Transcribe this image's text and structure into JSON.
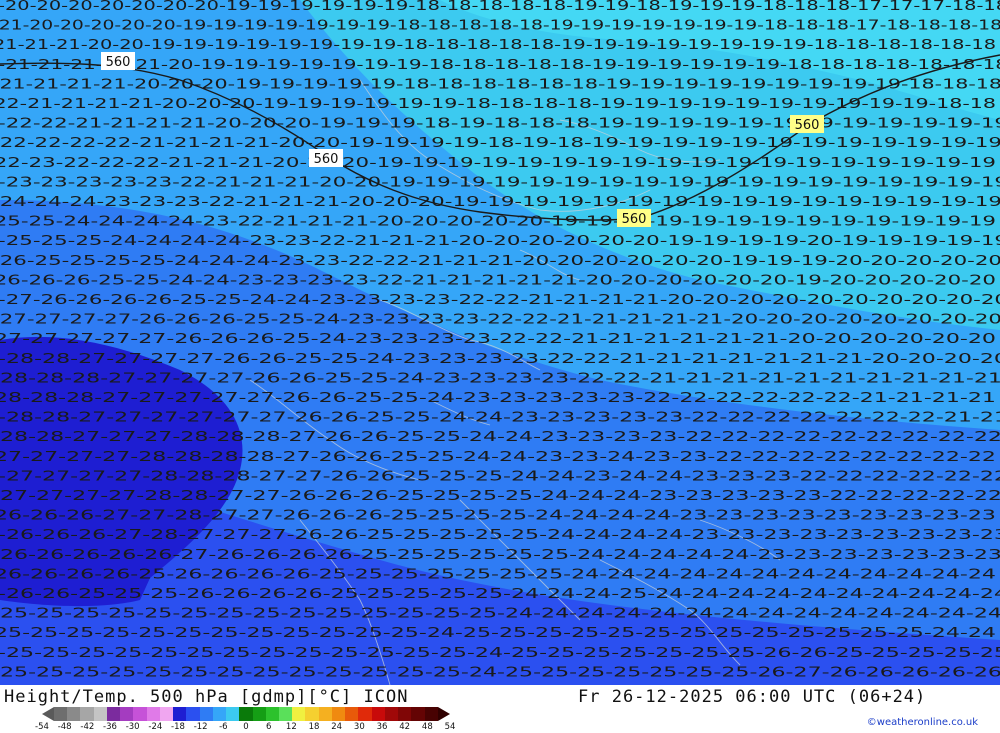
{
  "title": "Height/Temp. 500 hPa [gdmp][°C] ICON",
  "datetime": "Fr 26-12-2025 06:00 UTC (06+24)",
  "credit": "©weatheronline.co.uk",
  "contour_labels": [
    "560",
    "560",
    "560",
    "560"
  ],
  "legend": {
    "ticks": [
      "-54",
      "-48",
      "-42",
      "-36",
      "-30",
      "-24",
      "-18",
      "-12",
      "-6",
      "0",
      "6",
      "12",
      "18",
      "24",
      "30",
      "36",
      "42",
      "48",
      "54"
    ],
    "colors": [
      "#6e6e6e",
      "#8a8a8a",
      "#a6a6a6",
      "#c4c4c4",
      "#7b2b9e",
      "#a43cc0",
      "#c652d8",
      "#e07ae8",
      "#f0a6f0",
      "#1e1ed2",
      "#2b50f0",
      "#2f7cf4",
      "#35a6f8",
      "#3ccaf0",
      "#0a7a0a",
      "#159e15",
      "#2cc22c",
      "#5ae05a",
      "#f0f040",
      "#f5d030",
      "#f5b020",
      "#f08a10",
      "#e85a0a",
      "#e02a0a",
      "#c80a0a",
      "#a00808",
      "#800606",
      "#640404",
      "#480202"
    ],
    "min_color": "#5a5a5a",
    "max_color": "#300000"
  },
  "temperature_rows": [
    {
      "text": "-20-20-20-20-20-20-20-19-19-19-19-19-19-18-18-18-18-18-19-19-18-19-19-19-18-18-18-17-17-17-18-18"
    },
    {
      "text": "-21-20-20-20-20-20-19-19-19-19-19-19-19-18-18-18-18-18-19-19-19-19-19-19-19-18-18-18-17-18-18-18-18"
    },
    {
      "text": "-21-21-21-20-20-19-19-19-19-19-19-19-19-18-18-18-18-18-19-19-19-19-19-19-19-19-18-18-18-18-18-18"
    },
    {
      "text": "-21-21-21-21-21-20-19-19-19-19-19-19-19-18-18-18-18-18-19-19-19-19-19-19-18-18-18-18-18-18-18"
    },
    {
      "text": "-21-21-21-21-20-20-20-19-19-19-19-19-18-18-18-18-18-18-19-19-19-19-19-19-19-19-19-18-18-18"
    },
    {
      "text": "-22-21-21-21-21-20-20-20-19-19-19-19-19-19-18-18-18-18-19-19-19-19-19-19-19-19-19-19-18-18"
    },
    {
      "text": "-22-22-21-21-21-21-20-20-20-19-19-19-18-19-18-18-18-19-19-19-19-19-19-19-19-19-19-19-19"
    },
    {
      "text": "-22-22-22-22-21-21-21-21-20-20-19-19-19-19-18-19-18-19-19-19-19-19-19-19-19-19-19-19-19"
    },
    {
      "text": "-22-23-22-22-22-21-21-21-20-20-20-19-19-19-19-19-19-19-19-19-19-19-19-19-19-19-19-19-19"
    },
    {
      "text": "-23-23-23-23-23-22-21-21-21-20-20-19-19-19-19-19-19-19-19-19-19-19-19-19-19-19-19-19-19"
    },
    {
      "text": "-24-24-24-23-23-23-22-21-21-21-20-20-20-19-19-19-19-19-19-19-19-19-19-19-19-19-19-19-19"
    },
    {
      "text": "-25-25-24-24-24-24-23-22-21-21-21-20-20-20-20-20-19-19-19-19-19-19-19-19-19-19-19-19-19"
    },
    {
      "text": "-25-25-25-24-24-24-24-23-23-22-21-21-21-20-20-20-20-20-20-19-19-19-19-20-19-19-19-19-19"
    },
    {
      "text": "-26-25-25-25-25-24-24-24-23-23-22-22-21-21-21-20-20-20-20-20-20-19-19-19-20-20-20-20-20"
    },
    {
      "text": "-26-26-26-25-25-24-24-23-23-23-23-22-21-21-21-21-21-20-20-20-20-20-20-19-20-20-20-20-20"
    },
    {
      "text": "-27-26-26-26-26-25-25-24-24-23-23-23-23-22-22-21-21-21-21-20-20-20-20-20-20-20-20-20-20"
    },
    {
      "text": "-27-27-27-27-26-26-26-25-25-24-23-23-23-23-22-22-21-21-21-21-21-20-20-20-20-20-20-20-20"
    },
    {
      "text": "-27-27-27-27-27-26-26-26-25-24-23-23-23-23-22-22-21-21-21-21-21-21-20-20-20-20-20-20"
    },
    {
      "text": "-28-28-27-27-27-27-26-26-25-25-24-23-23-23-23-22-22-21-21-21-21-21-21-21-20-20-20-20"
    },
    {
      "text": "-28-28-28-27-27-27-27-26-26-25-25-24-23-23-23-23-22-22-21-21-21-21-21-21-21-21-21-21"
    },
    {
      "text": "-28-28-28-27-27-27-27-27-26-26-25-25-24-23-23-23-23-23-22-22-22-22-22-22-21-21-21-21"
    },
    {
      "text": "-28-28-27-27-27-27-27-27-26-26-25-25-24-24-23-23-23-23-23-22-22-22-22-22-22-22-21-21"
    },
    {
      "text": "-28-28-27-27-27-28-28-28-27-26-26-25-25-24-24-23-23-23-23-22-22-22-22-22-22-22-22-22"
    },
    {
      "text": "-27-27-27-27-28-28-28-28-27-26-26-25-25-24-24-23-23-24-23-23-22-22-22-22-22-22-22-22"
    },
    {
      "text": "-27-27-27-27-28-28-28-27-27-26-26-25-25-25-24-24-23-24-24-23-23-23-22-22-22-22-22-22"
    },
    {
      "text": "-27-27-27-27-28-28-27-27-26-26-26-25-25-25-25-24-24-24-23-23-23-23-23-22-22-22-22-22"
    },
    {
      "text": "-26-26-26-27-27-28-27-27-26-26-26-25-25-25-25-24-24-24-24-23-23-23-23-23-23-23-23-23"
    },
    {
      "text": "-26-26-26-27-28-27-27-27-26-26-25-25-25-25-25-24-24-24-24-23-23-23-23-23-23-23-23-23"
    },
    {
      "text": "-26-26-26-26-26-27-26-26-26-26-25-25-25-25-25-25-24-24-24-24-24-23-23-23-23-23-23-23"
    },
    {
      "text": "-26-26-26-26-25-26-26-26-26-25-25-25-25-25-25-25-24-24-24-24-24-24-24-24-24-24-24-24"
    },
    {
      "text": "-26-26-25-25-25-26-26-26-26-25-25-25-25-25-24-24-24-25-24-24-24-24-24-24-24-24-24-24"
    },
    {
      "text": "-25-25-25-25-25-25-25-25-25-25-25-25-25-25-24-24-24-24-24-24-24-24-24-24-24-24-24-24"
    },
    {
      "text": "-25-25-25-25-25-25-25-25-25-25-25-25-24-25-25-25-25-25-25-25-25-25-25-25-25-25-24-24"
    },
    {
      "text": "-25-25-25-25-25-25-25-25-25-25-25-25-25-24-25-25-25-25-25-25-25-26-26-25-25-25-25-25"
    },
    {
      "text": "-25-25-25-25-25-25-25-25-25-25-25-25-25-24-25-25-25-25-25-25-25-26-27-26-26-26-26-26"
    }
  ]
}
